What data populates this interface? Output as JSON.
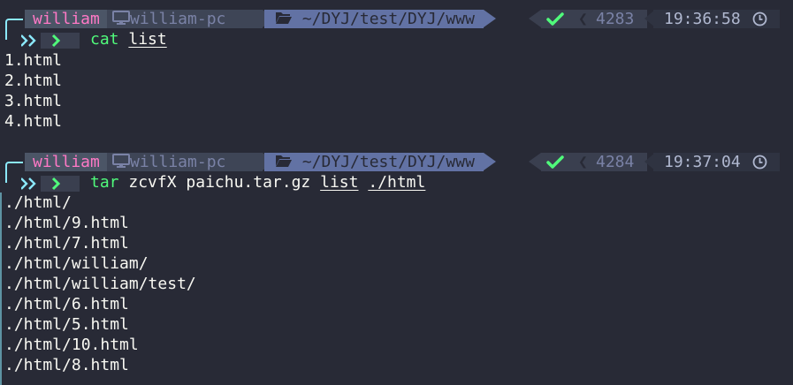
{
  "blocks": [
    {
      "prompt": {
        "user": "william",
        "host": "william-pc",
        "dir": "~/DYJ/test/DYJ/www",
        "count": "4283",
        "time": "19:36:58"
      },
      "command": {
        "name": "cat",
        "args": [
          "list"
        ]
      },
      "output": [
        "1.html",
        "2.html",
        "3.html",
        "4.html"
      ]
    },
    {
      "prompt": {
        "user": "william",
        "host": "william-pc",
        "dir": "~/DYJ/test/DYJ/www",
        "count": "4284",
        "time": "19:37:04"
      },
      "command": {
        "name": "tar",
        "args": [
          "zcvfX",
          "paichu.tar.gz",
          "list",
          "./html"
        ]
      },
      "output": [
        "./html/",
        "./html/9.html",
        "./html/7.html",
        "./html/william/",
        "./html/william/test/",
        "./html/6.html",
        "./html/5.html",
        "./html/10.html",
        "./html/8.html"
      ]
    }
  ],
  "colors": {
    "background": "#282a36",
    "user": "#ff79c6",
    "dir_bg": "#6272a4",
    "check": "#50fa7b",
    "command": "#50fa7b",
    "accent": "#8be9fd"
  },
  "icons": [
    "monitor-icon",
    "folder-open-icon",
    "check-icon",
    "clock-icon",
    "prompt-chevron-icon"
  ]
}
